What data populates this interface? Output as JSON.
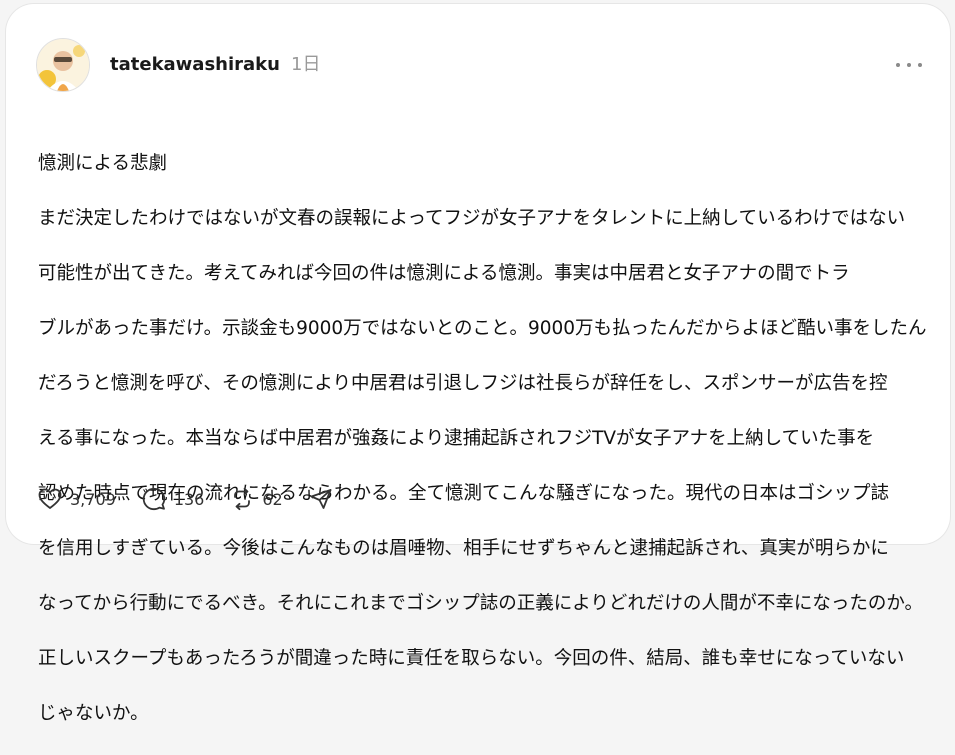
{
  "post": {
    "username": "tatekawashiraku",
    "time": "1日",
    "title": "憶測による悲劇",
    "lines": [
      "まだ決定したわけではないが文春の誤報によってフジが女子アナをタレントに上納しているわけではない",
      "可能性が出てきた。考えてみれば今回の件は憶測による憶測。事実は中居君と女子アナの間でトラ",
      "ブルがあった事だけ。示談金も9000万ではないとのこと。9000万も払ったんだからよほど酷い事をしたん",
      "だろうと憶測を呼び、その憶測により中居君は引退しフジは社長らが辞任をし、スポンサーが広告を控",
      "える事になった。本当ならば中居君が強姦により逮捕起訴されフジTVが女子アナを上納していた事を",
      "認めた時点で現在の流れになるならわかる。全て憶測てこんな騒ぎになった。現代の日本はゴシップ誌",
      "を信用しすぎている。今後はこんなものは眉唾物、相手にせずちゃんと逮捕起訴され、真実が明らかに",
      "なってから行動にでるべき。それにこれまでゴシップ誌の正義によりどれだけの人間が不幸になったのか。",
      "正しいスクープもあったろうが間違った時に責任を取らない。今回の件、結局、誰も幸せになっていない",
      "じゃないか。"
    ],
    "likes": "3,709",
    "comments": "136",
    "reposts": "62",
    "icons": {
      "avatar": "avatar-photo",
      "more": "more-options-icon",
      "like": "heart-icon",
      "comment": "comment-bubble-icon",
      "repost": "repost-icon",
      "share": "send-icon"
    }
  }
}
